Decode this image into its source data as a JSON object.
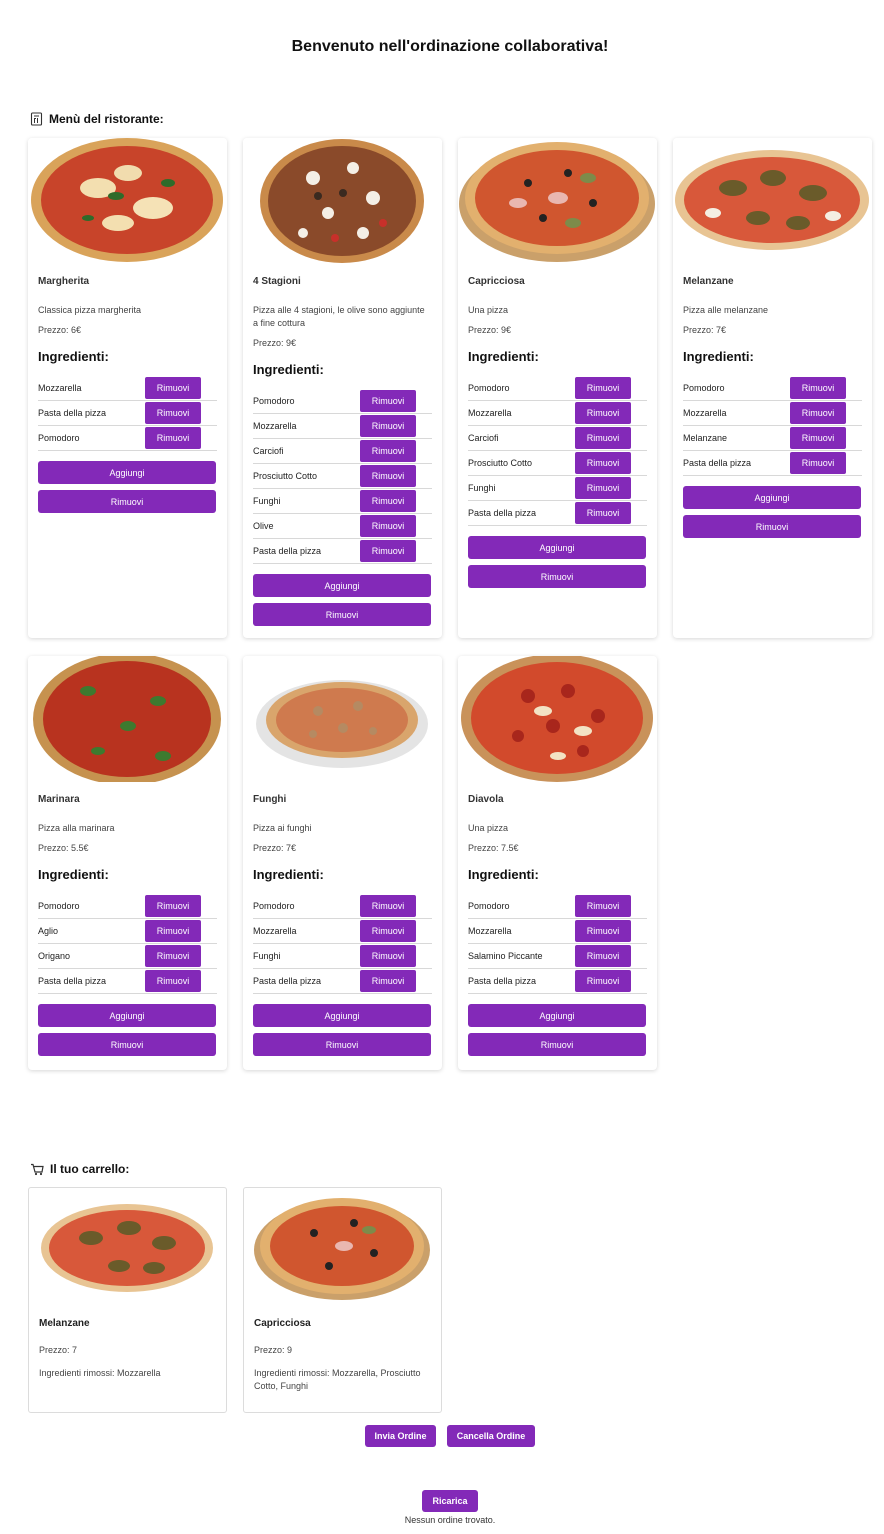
{
  "page": {
    "title": "Benvenuto nell'ordinazione collaborativa!"
  },
  "menu": {
    "heading": "Menù del ristorante:",
    "pizzas": [
      {
        "name": "Margherita",
        "description": "Classica pizza margherita",
        "price": "Prezzo: 6€",
        "ingredients": [
          "Mozzarella",
          "Pasta della pizza",
          "Pomodoro"
        ]
      },
      {
        "name": "4 Stagioni",
        "description": "Pizza alle 4 stagioni, le olive sono aggiunte a fine cottura",
        "price": "Prezzo: 9€",
        "ingredients": [
          "Pomodoro",
          "Mozzarella",
          "Carciofi",
          "Prosciutto Cotto",
          "Funghi",
          "Olive",
          "Pasta della pizza"
        ]
      },
      {
        "name": "Capricciosa",
        "description": "Una pizza",
        "price": "Prezzo: 9€",
        "ingredients": [
          "Pomodoro",
          "Mozzarella",
          "Carciofi",
          "Prosciutto Cotto",
          "Funghi",
          "Pasta della pizza"
        ]
      },
      {
        "name": "Melanzane",
        "description": "Pizza alle melanzane",
        "price": "Prezzo: 7€",
        "ingredients": [
          "Pomodoro",
          "Mozzarella",
          "Melanzane",
          "Pasta della pizza"
        ]
      },
      {
        "name": "Marinara",
        "description": "Pizza alla marinara",
        "price": "Prezzo: 5.5€",
        "ingredients": [
          "Pomodoro",
          "Aglio",
          "Origano",
          "Pasta della pizza"
        ]
      },
      {
        "name": "Funghi",
        "description": "Pizza ai funghi",
        "price": "Prezzo: 7€",
        "ingredients": [
          "Pomodoro",
          "Mozzarella",
          "Funghi",
          "Pasta della pizza"
        ]
      },
      {
        "name": "Diavola",
        "description": "Una pizza",
        "price": "Prezzo: 7.5€",
        "ingredients": [
          "Pomodoro",
          "Mozzarella",
          "Salamino Piccante",
          "Pasta della pizza"
        ]
      }
    ],
    "ingredients_title": "Ingredienti:",
    "remove_label": "Rimuovi",
    "add_label": "Aggiungi"
  },
  "cart": {
    "heading": "Il tuo carrello:",
    "items": [
      {
        "name": "Melanzane",
        "price": "Prezzo: 7",
        "removed": "Ingredienti rimossi: Mozzarella"
      },
      {
        "name": "Capricciosa",
        "price": "Prezzo: 9",
        "removed": "Ingredienti rimossi: Mozzarella, Prosciutto Cotto, Funghi"
      }
    ],
    "send_label": "Invia Ordine",
    "cancel_label": "Cancella Ordine"
  },
  "orders": {
    "reload_label": "Ricarica",
    "empty_text": "Nessun ordine trovato."
  },
  "colors": {
    "accent": "#8329b8"
  }
}
